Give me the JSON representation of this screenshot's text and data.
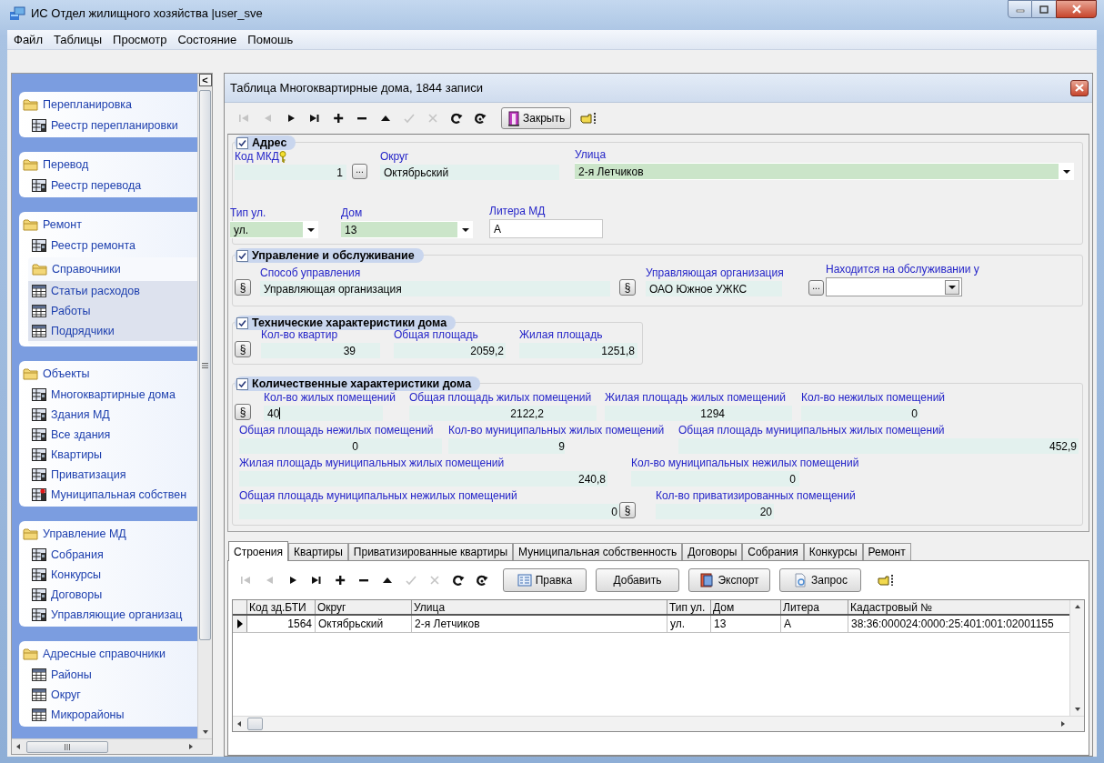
{
  "window": {
    "title": "ИС Отдел жилищного хозяйства |user_sve"
  },
  "menu": [
    "Файл",
    "Таблицы",
    "Просмотр",
    "Состояние",
    "Помошь"
  ],
  "sidebar": {
    "collapse_button": "<",
    "groups": [
      {
        "title": "Перепланировка",
        "items": [
          {
            "label": "Реестр перепланировки",
            "kind": "table"
          }
        ]
      },
      {
        "title": "Перевод",
        "items": [
          {
            "label": "Реестр перевода",
            "kind": "table"
          }
        ]
      },
      {
        "title": "Ремонт",
        "items": [
          {
            "label": "Реестр ремонта",
            "kind": "table"
          }
        ],
        "children": [
          {
            "title": "Справочники",
            "items": [
              {
                "label": "Статьи расходов",
                "kind": "grid"
              },
              {
                "label": "Работы",
                "kind": "grid"
              },
              {
                "label": "Подрядчики",
                "kind": "grid"
              }
            ]
          }
        ]
      },
      {
        "title": "Объекты",
        "items": [
          {
            "label": "Многоквартирные дома",
            "kind": "table"
          },
          {
            "label": "Здания МД",
            "kind": "table"
          },
          {
            "label": "Все здания",
            "kind": "table"
          },
          {
            "label": "Квартиры",
            "kind": "table"
          },
          {
            "label": "Приватизация",
            "kind": "table"
          },
          {
            "label": "Муниципальная собствен",
            "kind": "flagged"
          }
        ]
      },
      {
        "title": "Управление МД",
        "items": [
          {
            "label": "Собрания",
            "kind": "table"
          },
          {
            "label": "Конкурсы",
            "kind": "table"
          },
          {
            "label": "Договоры",
            "kind": "table"
          },
          {
            "label": "Управляющие организац",
            "kind": "table"
          }
        ]
      },
      {
        "title": "Адресные справочники",
        "items": [
          {
            "label": "Районы",
            "kind": "grid"
          },
          {
            "label": "Округ",
            "kind": "grid"
          },
          {
            "label": "Микрорайоны",
            "kind": "grid"
          }
        ]
      }
    ]
  },
  "panel": {
    "title": "Таблица Многоквартирные дома, 1844 записи",
    "navigator": [
      {
        "kind": "first",
        "disabled": true
      },
      {
        "kind": "prior",
        "disabled": true
      },
      {
        "kind": "next",
        "disabled": false
      },
      {
        "kind": "last",
        "disabled": false
      },
      {
        "kind": "insert",
        "disabled": false
      },
      {
        "kind": "delete",
        "disabled": false
      },
      {
        "kind": "edit",
        "disabled": false
      },
      {
        "kind": "post",
        "disabled": true
      },
      {
        "kind": "cancel",
        "disabled": true
      },
      {
        "kind": "refresh",
        "disabled": false
      },
      {
        "kind": "refresh_all",
        "disabled": false
      }
    ],
    "close_button": "Закрыть",
    "groups": [
      {
        "title": "Адрес",
        "checked": true,
        "lines": [
          [
            {
              "kind": "number",
              "label": "Код МКД",
              "key": true,
              "value": "1"
            },
            {
              "kind": "ellipsis",
              "text": "..."
            },
            {
              "kind": "text",
              "label": "Округ",
              "value": "Октябрьский"
            },
            {
              "kind": "combo",
              "label": "Улица",
              "value": "2-я Летчиков"
            }
          ],
          [
            {
              "kind": "combo",
              "label": "Тип ул.",
              "value": "ул."
            },
            {
              "kind": "combo",
              "label": "Дом",
              "value": "13"
            },
            {
              "kind": "edit",
              "label": "Литера МД",
              "value": "А"
            }
          ]
        ]
      },
      {
        "title": "Управление и обслуживание",
        "checked": true,
        "lines": [
          [
            {
              "kind": "section",
              "text": "§"
            },
            {
              "kind": "text",
              "label": "Способ управления",
              "value": "Управляющая организация"
            },
            {
              "kind": "section",
              "text": "§"
            },
            {
              "kind": "text",
              "label": "Управляющая организация",
              "value": "ОАО Южное УЖКС"
            },
            {
              "kind": "ellipsis",
              "text": "..."
            },
            {
              "kind": "select",
              "label": "Находится на обслуживании у"
            }
          ]
        ]
      },
      {
        "title": "Технические характеристики дома",
        "checked": true,
        "lines": [
          [
            {
              "kind": "section",
              "text": "§"
            },
            {
              "kind": "number",
              "label": "Кол-во квартир",
              "value": "39"
            },
            {
              "kind": "number",
              "label": "Общая площадь",
              "value": "2059,2"
            },
            {
              "kind": "number",
              "label": "Жилая площадь",
              "value": "1251,8"
            }
          ]
        ]
      },
      {
        "title": "Количественные характеристики дома",
        "checked": true,
        "lines": [
          [
            {
              "kind": "section",
              "text": "§"
            },
            {
              "kind": "text",
              "label": "Кол-во жилых помещений",
              "value": "40",
              "focused": true
            },
            {
              "kind": "number",
              "label": "Общая площадь жилых помещений",
              "value": "2122,2"
            },
            {
              "kind": "number",
              "label": "Жилая площадь жилых помещений",
              "value": "1294"
            },
            {
              "kind": "number",
              "label": "Кол-во нежилых помещений",
              "value": "0"
            }
          ],
          [
            {
              "kind": "number",
              "label": "Общая площадь нежилых помещений",
              "value": "0"
            },
            {
              "kind": "number",
              "label": "Кол-во муниципальных жилых помещений",
              "value": "9"
            },
            {
              "kind": "number",
              "label": "Общая площадь муниципальных жилых помещений",
              "value": "452,9"
            }
          ],
          [
            {
              "kind": "number",
              "label": "Жилая площадь муниципальных жилых помещений",
              "value": "240,8"
            },
            {
              "kind": "number",
              "label": "Кол-во муниципальных нежилых помещений",
              "value": "0"
            }
          ],
          [
            {
              "kind": "number",
              "label": "Общая площадь муниципальных нежилых помещений",
              "value": "0"
            },
            {
              "kind": "section",
              "text": "§"
            },
            {
              "kind": "number",
              "label": "Кол-во приватизированных помещений",
              "value": "20"
            }
          ]
        ]
      }
    ],
    "tabs": [
      {
        "label": "Строения",
        "selected": true
      },
      {
        "label": "Квартиры",
        "selected": false
      },
      {
        "label": "Приватизированные квартиры",
        "selected": false
      },
      {
        "label": "Муниципальная собственность",
        "selected": false
      },
      {
        "label": "Договоры",
        "selected": false
      },
      {
        "label": "Собрания",
        "selected": false
      },
      {
        "label": "Конкурсы",
        "selected": false
      },
      {
        "label": "Ремонт",
        "selected": false
      }
    ],
    "sub_navigator": [
      {
        "kind": "first",
        "disabled": true
      },
      {
        "kind": "prior",
        "disabled": true
      },
      {
        "kind": "next",
        "disabled": false
      },
      {
        "kind": "last",
        "disabled": false
      },
      {
        "kind": "insert",
        "disabled": false
      },
      {
        "kind": "delete",
        "disabled": false
      },
      {
        "kind": "edit",
        "disabled": false
      },
      {
        "kind": "post",
        "disabled": true
      },
      {
        "kind": "cancel",
        "disabled": true
      },
      {
        "kind": "refresh",
        "disabled": false
      },
      {
        "kind": "refresh_all",
        "disabled": false
      }
    ],
    "sub_buttons": [
      {
        "kind": "edit",
        "label": "Правка"
      },
      {
        "kind": "add",
        "label": "Добавить"
      },
      {
        "kind": "export",
        "label": "Экспорт"
      },
      {
        "kind": "query",
        "label": "Запрос"
      }
    ],
    "table": {
      "columns": [
        "Код зд.БТИ",
        "Округ",
        "Улица",
        "Тип ул.",
        "Дом",
        "Литера",
        "Кадастровый №"
      ],
      "rows": [
        {
          "selected": true,
          "cells": [
            "1564",
            "Октябрьский",
            "2-я Летчиков",
            "ул.",
            "13",
            "А",
            "38:36:000024:0000:25:401:001:02001155"
          ]
        }
      ]
    }
  }
}
